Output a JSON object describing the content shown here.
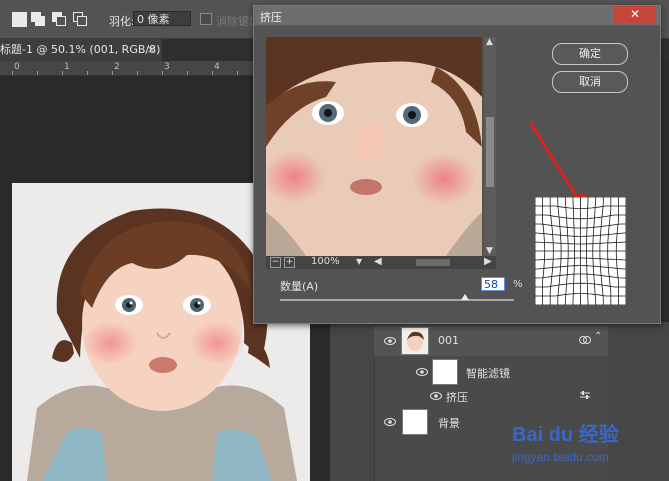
{
  "options_bar": {
    "feather_label": "羽化:",
    "feather_value": "0 像素",
    "antialias_label": "消除锯齿"
  },
  "document": {
    "tab_title": "标题-1 @ 50.1% (001, RGB/8) *",
    "tab_close": "×",
    "ruler_labels": [
      "0",
      "1",
      "2",
      "3",
      "4"
    ]
  },
  "dialog": {
    "title": "挤压",
    "close": "✕",
    "ok_label": "确定",
    "cancel_label": "取消",
    "zoom_minus": "−",
    "zoom_plus": "+",
    "zoom_value": "100%",
    "amount_label": "数量(A)",
    "amount_value": "58",
    "amount_unit": "%",
    "amount_fraction": 0.79
  },
  "layers": {
    "items": [
      {
        "name": "001"
      },
      {
        "name": "智能滤镜"
      },
      {
        "name": "挤压"
      },
      {
        "name": "背景"
      }
    ]
  },
  "watermark": {
    "line1": "Bai du 经验",
    "line2": "jingyan.baidu.com"
  },
  "colors": {
    "accent": "#3a67c6",
    "close_red": "#c6453a",
    "arrow_red": "#e02020"
  }
}
